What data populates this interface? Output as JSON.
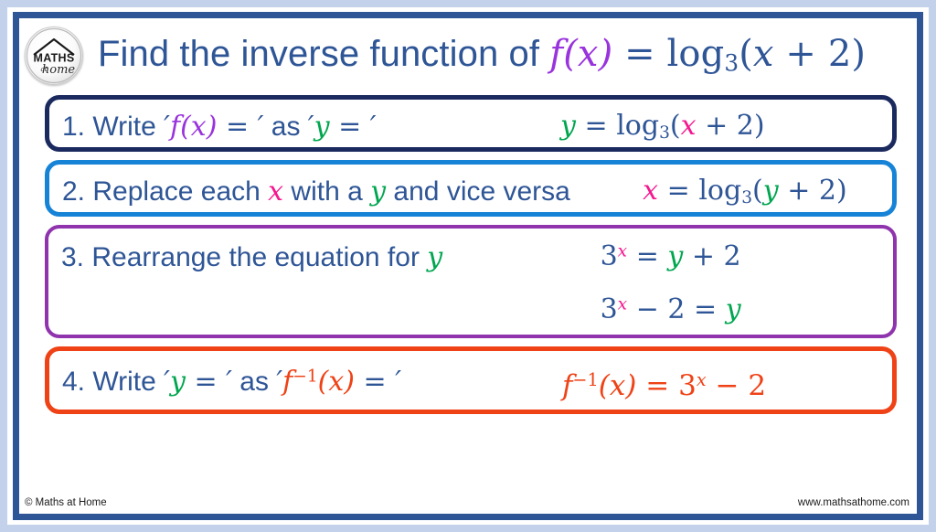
{
  "header": {
    "logo": {
      "icon": "maths-at-home-circular-logo",
      "line1": "MATHS",
      "line2": "at",
      "line3": "home"
    },
    "title_prefix": "Find the inverse function of ",
    "title_func": "f(x)",
    "title_equals": " = ",
    "title_log": "log",
    "title_base": "3",
    "title_arg_open": "(",
    "title_arg_x": "x",
    "title_arg_rest": " + 2)"
  },
  "steps": [
    {
      "number": "1.",
      "label_a": " Write ",
      "quote_open": "′",
      "term_func": "f(x)",
      "label_eq1": " = ",
      "quote_close": "′",
      "label_b": " as ",
      "term_y": "y",
      "label_eq2": " = ",
      "border_color": "#1b2a5e",
      "equation": {
        "lhs": "y",
        "eq": " = ",
        "log": "log",
        "base": "3",
        "open": "(",
        "var": "x",
        "rest": " + 2)"
      }
    },
    {
      "number": "2.",
      "label_a": " Replace each ",
      "term_x": "x",
      "label_b": " with a ",
      "term_y": "y",
      "label_c": " and vice versa",
      "border_color": "#1683d6",
      "equation": {
        "lhs": "x",
        "eq": " = ",
        "log": "log",
        "base": "3",
        "open": "(",
        "var": "y",
        "rest": " + 2)"
      }
    },
    {
      "number": "3.",
      "label_a": " Rearrange the equation for ",
      "term_y": "y",
      "border_color": "#8f34ad",
      "equation_1": {
        "three": "3",
        "exp": "x",
        "eq": " = ",
        "y": "y",
        "rest": " + 2"
      },
      "equation_2": {
        "three": "3",
        "exp": "x",
        "minus": " − 2 = ",
        "y": "y"
      }
    },
    {
      "number": "4.",
      "label_a": " Write ",
      "quote_open": "′",
      "term_y": "y",
      "label_eq1": " = ",
      "quote_close": "′",
      "label_b": " as ",
      "term_finv": "f",
      "finv_exp": "−1",
      "finv_arg": "(x)",
      "label_eq2": " = ",
      "border_color": "#ef4216",
      "equation": {
        "f": "f",
        "exp": "−1",
        "arg": "(x)",
        "eq": " = 3",
        "pow": "x",
        "rest": " − 2"
      }
    }
  ],
  "footer": {
    "copyright": "© Maths at Home",
    "website": "www.mathsathome.com"
  },
  "colors": {
    "frame": "#2e5596",
    "outer_bg": "#c3d2ea",
    "text_navy": "#2e5596",
    "purple": "#9933dd",
    "green": "#00a64f",
    "pink": "#f5188f",
    "orange": "#ef4216"
  }
}
